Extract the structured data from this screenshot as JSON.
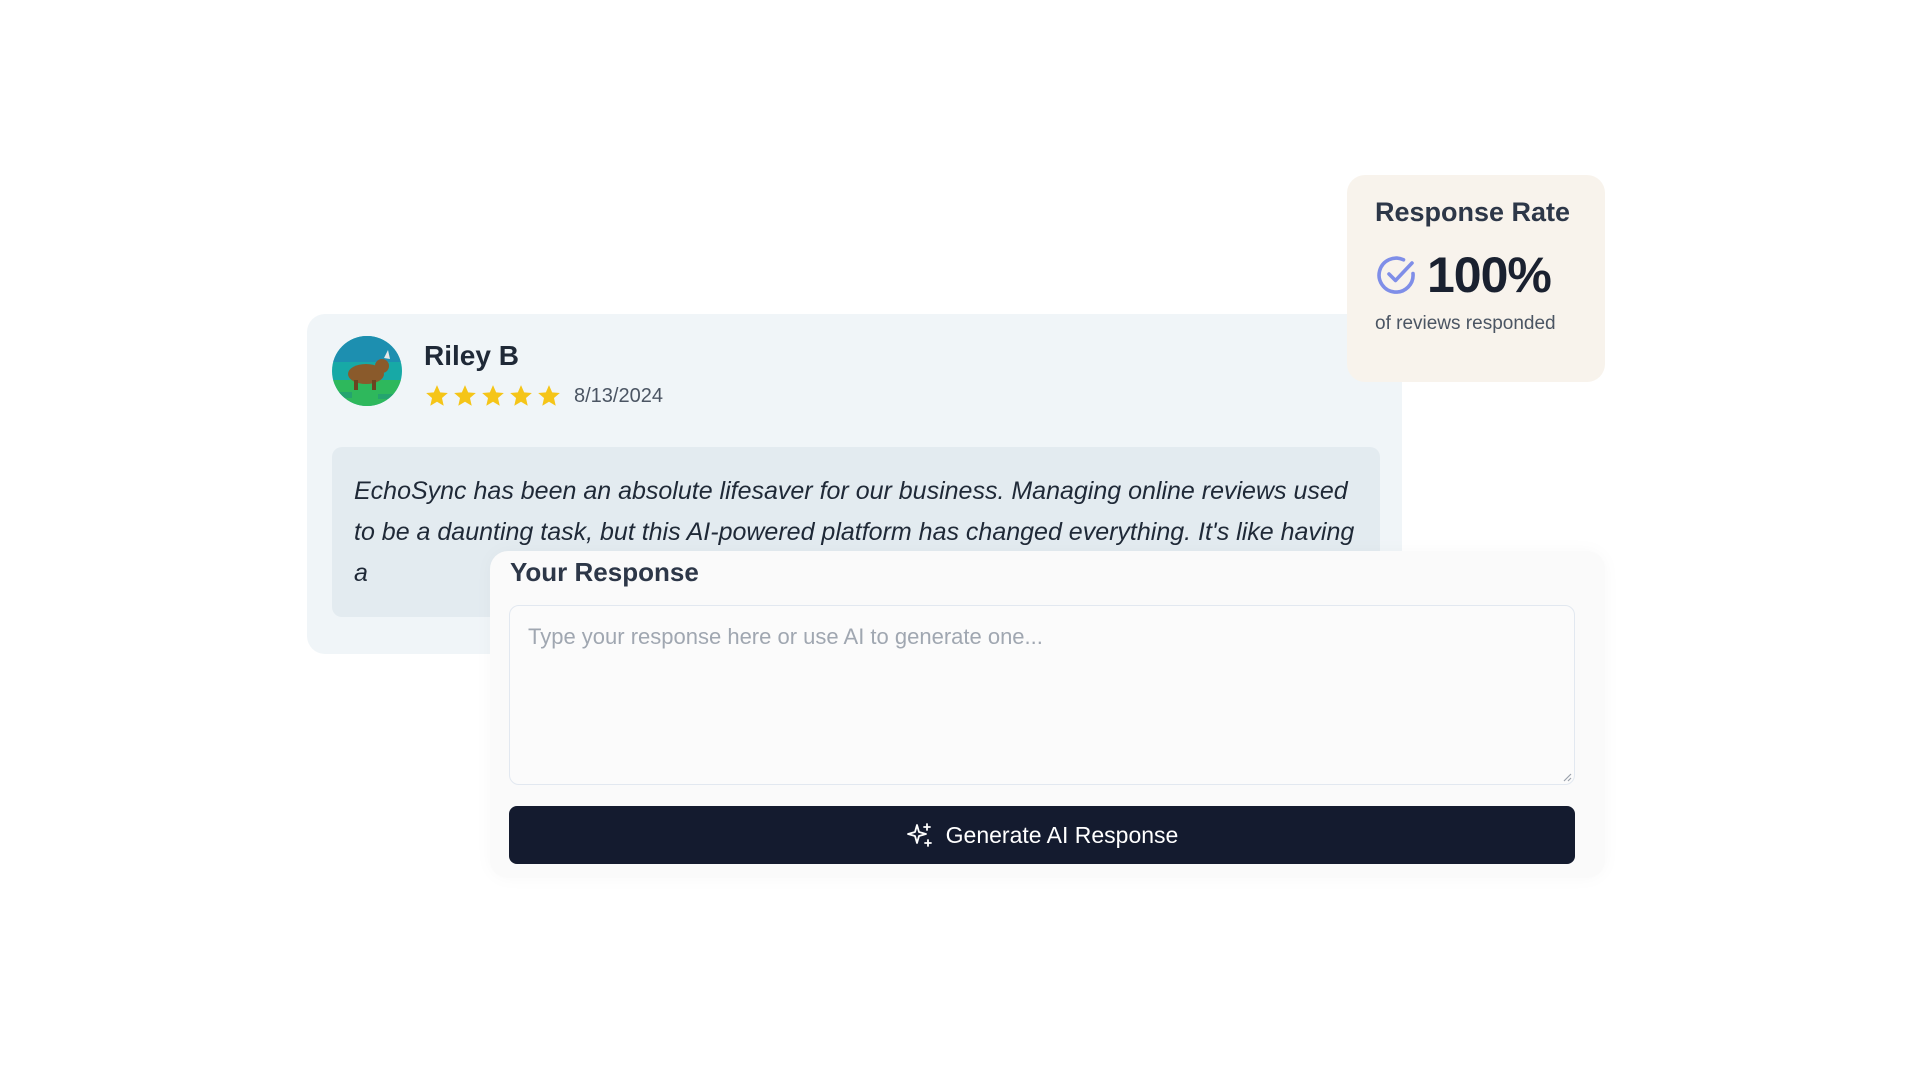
{
  "review": {
    "reviewer_name": "Riley B",
    "avatar_icon": "avatar-image",
    "rating": 5,
    "rating_max": 5,
    "star_color": "#f5c518",
    "date": "8/13/2024",
    "body": "EchoSync has been an absolute lifesaver for our business. Managing online reviews used to be a daunting task, but this AI-powered platform has changed everything. It's like having a"
  },
  "response_rate": {
    "title": "Response Rate",
    "value": "100%",
    "caption": "of reviews responded",
    "icon": "check-circle-icon",
    "icon_color": "#7f8ee8"
  },
  "response": {
    "label": "Your Response",
    "placeholder": "Type your response here or use AI to generate one...",
    "value": "",
    "generate_button_label": "Generate AI Response",
    "generate_button_icon": "sparkle-icon",
    "button_color": "#141b2f"
  }
}
